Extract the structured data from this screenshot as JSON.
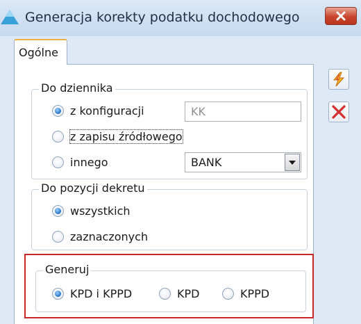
{
  "window": {
    "title": "Generacja korekty podatku dochodowego",
    "icons": {
      "app": "triangle-icon",
      "close": "close-x-icon"
    }
  },
  "tabs": [
    {
      "label": "Ogólne",
      "selected": true
    }
  ],
  "groups": {
    "dziennik": {
      "legend": "Do dziennika",
      "options": [
        {
          "label": "z konfiguracji",
          "checked": true
        },
        {
          "label": "z zapisu źródłowego",
          "checked": false
        },
        {
          "label": "innego",
          "checked": false
        }
      ],
      "konfiguracja_value": "KK",
      "innego_value": "BANK"
    },
    "pozycje": {
      "legend": "Do pozycji dekretu",
      "options": [
        {
          "label": "wszystkich",
          "checked": true
        },
        {
          "label": "zaznaczonych",
          "checked": false
        }
      ]
    },
    "generuj": {
      "legend": "Generuj",
      "options": [
        {
          "label": "KPD i KPPD",
          "checked": true
        },
        {
          "label": "KPD",
          "checked": false
        },
        {
          "label": "KPPD",
          "checked": false
        }
      ]
    }
  },
  "side_buttons": [
    {
      "icon": "lightning-icon",
      "color": "#f0a020"
    },
    {
      "icon": "cancel-x-icon",
      "color": "#d32f2f"
    }
  ],
  "colors": {
    "highlight": "#c62828",
    "titlebar": "#c6d9ee"
  }
}
